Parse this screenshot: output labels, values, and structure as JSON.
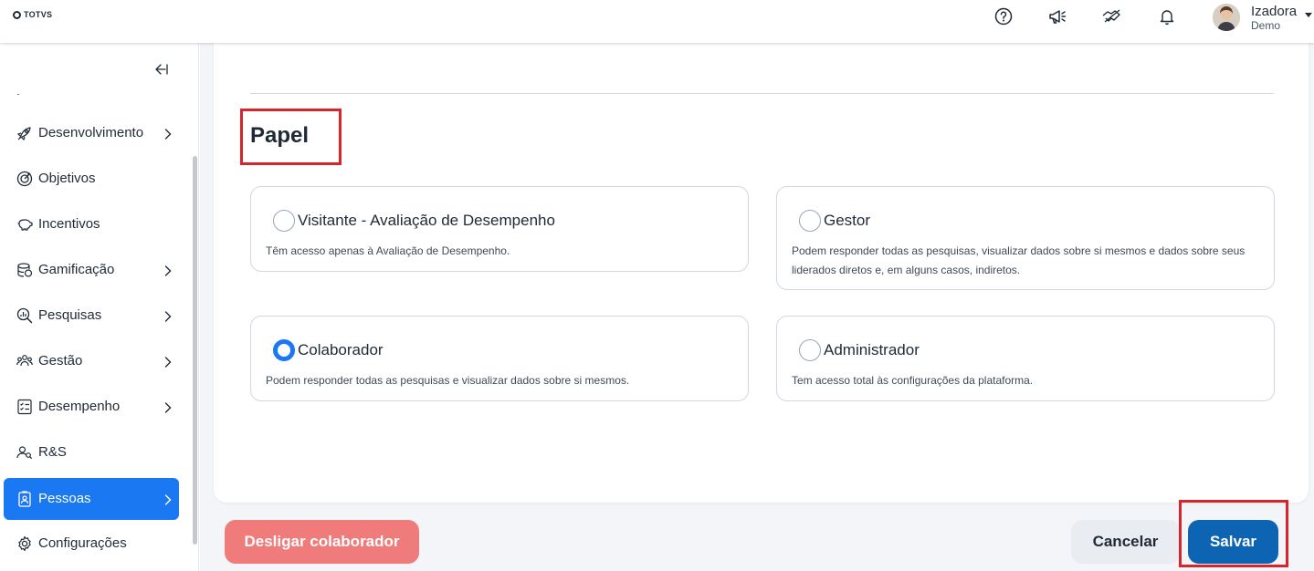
{
  "header": {
    "logo_text": "TOTVS",
    "user_name": "Izadora",
    "user_subtitle": "Demo",
    "icons": [
      "help-icon",
      "megaphone-icon",
      "handshake-icon",
      "bell-icon"
    ]
  },
  "sidebar": {
    "collapse_icon": "collapse-left-icon",
    "items": [
      {
        "label": "Desenvolvimento",
        "icon": "rocket-icon",
        "has_chevron": true
      },
      {
        "label": "Objetivos",
        "icon": "target-icon",
        "has_chevron": false
      },
      {
        "label": "Incentivos",
        "icon": "piggy-bank-icon",
        "has_chevron": false
      },
      {
        "label": "Gamificação",
        "icon": "coins-icon",
        "has_chevron": true
      },
      {
        "label": "Pesquisas",
        "icon": "search-chart-icon",
        "has_chevron": true
      },
      {
        "label": "Gestão",
        "icon": "team-icon",
        "has_chevron": true
      },
      {
        "label": "Desempenho",
        "icon": "checklist-icon",
        "has_chevron": true
      },
      {
        "label": "R&S",
        "icon": "people-search-icon",
        "has_chevron": false
      },
      {
        "label": "Pessoas",
        "icon": "badge-icon",
        "has_chevron": true,
        "active": true
      },
      {
        "label": "Configurações",
        "icon": "gear-icon",
        "has_chevron": false
      }
    ]
  },
  "main": {
    "section_title": "Papel",
    "roles": [
      {
        "name": "Visitante - Avaliação de Desempenho",
        "description": "Têm acesso apenas à Avaliação de Desempenho.",
        "selected": false
      },
      {
        "name": "Gestor",
        "description": "Podem responder todas as pesquisas, visualizar dados sobre si mesmos e dados sobre seus liderados diretos e, em alguns casos, indiretos.",
        "selected": false
      },
      {
        "name": "Colaborador",
        "description": "Podem responder todas as pesquisas e visualizar dados sobre si mesmos.",
        "selected": true
      },
      {
        "name": "Administrador",
        "description": "Tem acesso total às configurações da plataforma.",
        "selected": false
      }
    ]
  },
  "footer": {
    "desligar_label": "Desligar colaborador",
    "cancelar_label": "Cancelar",
    "salvar_label": "Salvar"
  },
  "colors": {
    "accent": "#1a78f2",
    "save_button": "#0d64b2",
    "danger_button": "#f07b7b",
    "highlight": "#d7262b"
  }
}
